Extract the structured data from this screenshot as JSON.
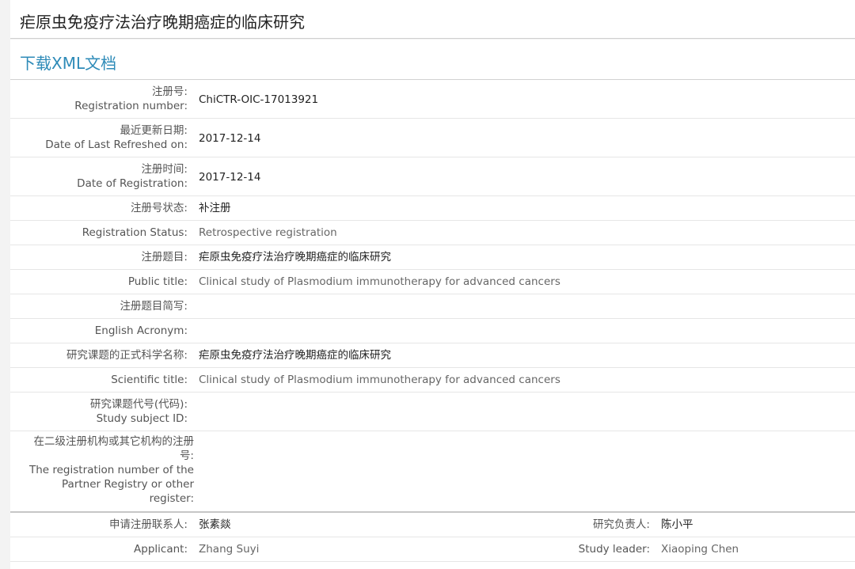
{
  "page": {
    "title": "疟原虫免疫疗法治疗晚期癌症的临床研究"
  },
  "download": {
    "label": "下载XML文档"
  },
  "rows": [
    {
      "label_cn": "注册号:",
      "label_en": "Registration number:",
      "value": "ChiCTR-OIC-17013921"
    },
    {
      "label_cn": "最近更新日期:",
      "label_en": "Date of Last Refreshed on:",
      "value": "2017-12-14"
    },
    {
      "label_cn": "注册时间:",
      "label_en": "Date of Registration:",
      "value": "2017-12-14"
    },
    {
      "label": "注册号状态:",
      "value": "补注册"
    },
    {
      "label": "Registration Status:",
      "value": "Retrospective registration"
    },
    {
      "label": "注册题目:",
      "value": "疟原虫免疫疗法治疗晚期癌症的临床研究"
    },
    {
      "label": "Public title:",
      "value": "Clinical study of Plasmodium immunotherapy for advanced cancers"
    },
    {
      "label": "注册题目简写:",
      "value": ""
    },
    {
      "label": "English Acronym:",
      "value": ""
    },
    {
      "label": "研究课题的正式科学名称:",
      "value": "疟原虫免疫疗法治疗晚期癌症的临床研究"
    },
    {
      "label": "Scientific title:",
      "value": "Clinical study of Plasmodium immunotherapy for advanced cancers"
    },
    {
      "label_cn": "研究课题代号(代码):",
      "label_en": "Study subject ID:",
      "value": ""
    },
    {
      "label_lines": [
        "在二级注册机构或其它机构的注册",
        "号:",
        "The registration number of the",
        "Partner Registry or other",
        "register:"
      ],
      "value": ""
    }
  ],
  "contacts": [
    {
      "label": "申请注册联系人:",
      "value": "张素燚",
      "label2": "研究负责人:",
      "value2": "陈小平"
    },
    {
      "label": "Applicant:",
      "value": "Zhang Suyi",
      "label2": "Study leader:",
      "value2": "Xiaoping Chen"
    }
  ]
}
